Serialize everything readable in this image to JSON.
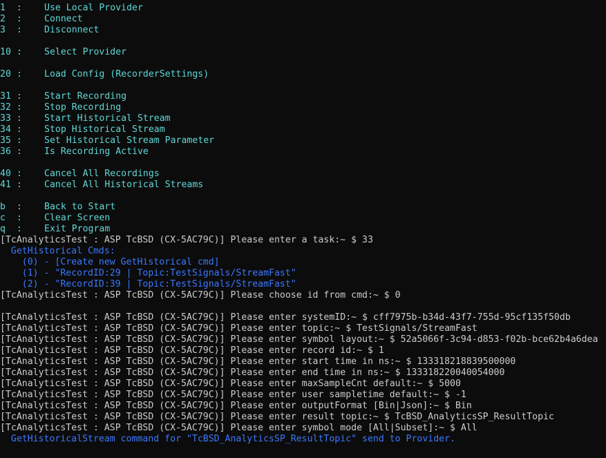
{
  "window": {
    "type": "console"
  },
  "colors": {
    "background": "#0c0c0c",
    "menu_text": "#61d6d6",
    "prompt_text": "#cccccc",
    "info_text": "#3b78ff"
  },
  "menu_groups": [
    [
      {
        "key": "1  :",
        "label": "Use Local Provider"
      },
      {
        "key": "2  :",
        "label": "Connect"
      },
      {
        "key": "3  :",
        "label": "Disconnect"
      }
    ],
    [
      {
        "key": "10 :",
        "label": "Select Provider"
      }
    ],
    [
      {
        "key": "20 :",
        "label": "Load Config (RecorderSettings)"
      }
    ],
    [
      {
        "key": "31 :",
        "label": "Start Recording"
      },
      {
        "key": "32 :",
        "label": "Stop Recording"
      },
      {
        "key": "33 :",
        "label": "Start Historical Stream"
      },
      {
        "key": "34 :",
        "label": "Stop Historical Stream"
      },
      {
        "key": "35 :",
        "label": "Set Historical Stream Parameter"
      },
      {
        "key": "36 :",
        "label": "Is Recording Active"
      }
    ],
    [
      {
        "key": "40 :",
        "label": "Cancel All Recordings"
      },
      {
        "key": "41 :",
        "label": "Cancel All Historical Streams"
      }
    ],
    [
      {
        "key": "b  :",
        "label": "Back to Start"
      },
      {
        "key": "c  :",
        "label": "Clear Screen"
      },
      {
        "key": "q  :",
        "label": "Exit Program"
      }
    ]
  ],
  "session_1": [
    {
      "style": "prompt",
      "text": "[TcAnalyticsTest : ASP TcBSD (CX-5AC79C)] Please enter a task:~ $ 33"
    },
    {
      "style": "blue",
      "text": "  GetHistorical Cmds:"
    },
    {
      "style": "blue",
      "text": "    (0) - [Create new GetHistorical cmd]"
    },
    {
      "style": "blue",
      "text": "    (1) - \"RecordID:29 | Topic:TestSignals/StreamFast\""
    },
    {
      "style": "blue",
      "text": "    (2) - \"RecordID:39 | Topic:TestSignals/StreamFast\""
    },
    {
      "style": "prompt",
      "text": "[TcAnalyticsTest : ASP TcBSD (CX-5AC79C)] Please choose id from cmd:~ $ 0"
    }
  ],
  "session_2": [
    {
      "style": "prompt",
      "text": "[TcAnalyticsTest : ASP TcBSD (CX-5AC79C)] Please enter systemID:~ $ cff7975b-b34d-43f7-755d-95cf135f50db"
    },
    {
      "style": "prompt",
      "text": "[TcAnalyticsTest : ASP TcBSD (CX-5AC79C)] Please enter topic:~ $ TestSignals/StreamFast"
    },
    {
      "style": "prompt",
      "text": "[TcAnalyticsTest : ASP TcBSD (CX-5AC79C)] Please enter symbol layout:~ $ 52a5066f-3c94-d853-f02b-bce62b4a6dea"
    },
    {
      "style": "prompt",
      "text": "[TcAnalyticsTest : ASP TcBSD (CX-5AC79C)] Please enter record id:~ $ 1"
    },
    {
      "style": "prompt",
      "text": "[TcAnalyticsTest : ASP TcBSD (CX-5AC79C)] Please enter start time in ns:~ $ 133318218839500000"
    },
    {
      "style": "prompt",
      "text": "[TcAnalyticsTest : ASP TcBSD (CX-5AC79C)] Please enter end time in ns:~ $ 133318220040054000"
    },
    {
      "style": "prompt",
      "text": "[TcAnalyticsTest : ASP TcBSD (CX-5AC79C)] Please enter maxSampleCnt default:~ $ 5000"
    },
    {
      "style": "prompt",
      "text": "[TcAnalyticsTest : ASP TcBSD (CX-5AC79C)] Please enter user sampletime default:~ $ -1"
    },
    {
      "style": "prompt",
      "text": "[TcAnalyticsTest : ASP TcBSD (CX-5AC79C)] Please enter outputFormat [Bin|Json]:~ $ Bin"
    },
    {
      "style": "prompt",
      "text": "[TcAnalyticsTest : ASP TcBSD (CX-5AC79C)] Please enter result topic:~ $ TcBSD_AnalyticsSP_ResultTopic"
    },
    {
      "style": "prompt",
      "text": "[TcAnalyticsTest : ASP TcBSD (CX-5AC79C)] Please enter symbol mode [All|Subset]:~ $ All"
    },
    {
      "style": "blue",
      "text": "  GetHistoricalStream command for \"TcBSD_AnalyticsSP_ResultTopic\" send to Provider."
    }
  ]
}
